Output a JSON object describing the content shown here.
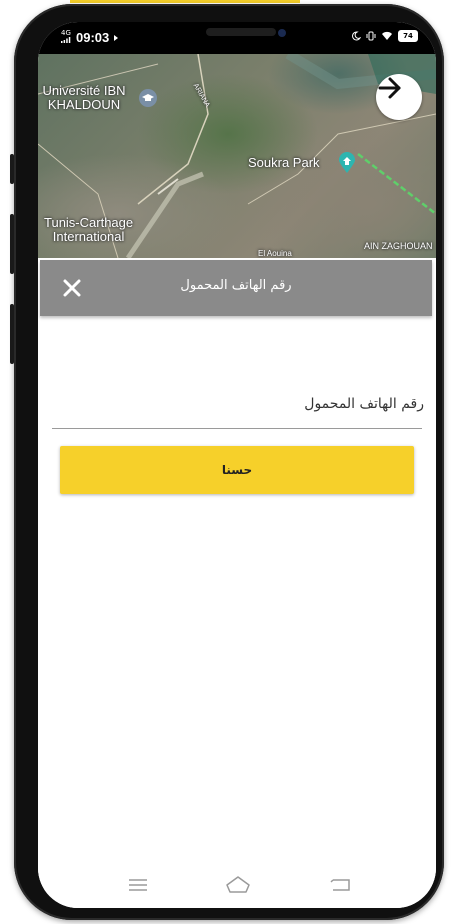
{
  "status_bar": {
    "network": "4G",
    "time": "09:03",
    "battery": "74"
  },
  "map": {
    "labels": {
      "university": "Université IBN\nKHALDOUN",
      "ariana": "ARIANA",
      "soukra_park": "Soukra Park",
      "airport": "Tunis-Carthage\nInternational",
      "el_aouina": "El Aouina",
      "ain_zaghouan": "AIN ZAGHOUAN"
    }
  },
  "dialog": {
    "title": "رقم الهاتف المحمول",
    "phone_input": {
      "placeholder": "رقم الهاتف المحمول",
      "value": ""
    },
    "ok_button_label": "حسنا"
  },
  "colors": {
    "header_gray": "#8a8a8a",
    "button_yellow": "#f6d02a",
    "status_bar": "#000000"
  },
  "icons": {
    "close": "close-icon",
    "arrow": "arrow-right-icon",
    "nav_menu": "menu-icon",
    "nav_home": "home-icon",
    "nav_back": "back-icon"
  }
}
